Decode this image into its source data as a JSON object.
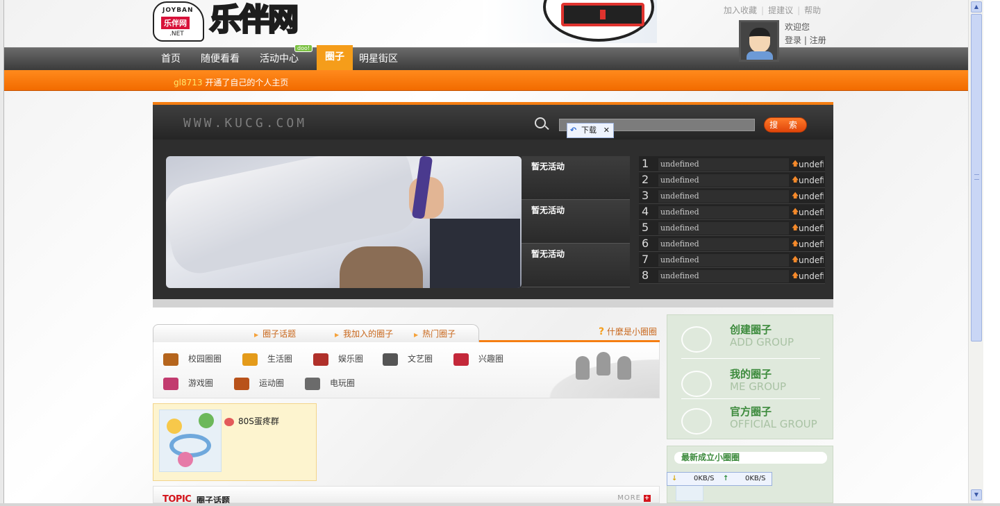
{
  "header": {
    "logo_small": "JOYBAN",
    "logo_cn": "乐伴网",
    "logo_net": ".NET",
    "logo_big": "乐伴网",
    "top_links": [
      "加入收藏",
      "提建议",
      "帮助"
    ],
    "welcome": "欢迎您",
    "login": "登录",
    "register": "注册"
  },
  "nav": {
    "items": [
      "首页",
      "随便看看",
      "活动中心",
      "圈子",
      "明星街区"
    ],
    "active": "圈子",
    "new_badge": "doo!"
  },
  "ticker": {
    "user": "gl8713",
    "message": "开通了自己的个人主页"
  },
  "search": {
    "site_url": "WWW.KUCG.COM",
    "input_value": "",
    "button_label": "搜 索",
    "download_tip": "下载",
    "download_arrow": "↶",
    "download_close": "✕"
  },
  "activities": [
    "暂无活动",
    "暂无活动",
    "暂无活动"
  ],
  "ranking": [
    {
      "rank": "1",
      "name": "undefined",
      "value": "undefi"
    },
    {
      "rank": "2",
      "name": "undefined",
      "value": "undefi"
    },
    {
      "rank": "3",
      "name": "undefined",
      "value": "undefi"
    },
    {
      "rank": "4",
      "name": "undefined",
      "value": "undefi"
    },
    {
      "rank": "5",
      "name": "undefined",
      "value": "undefi"
    },
    {
      "rank": "6",
      "name": "undefined",
      "value": "undefi"
    },
    {
      "rank": "7",
      "name": "undefined",
      "value": "undefi"
    },
    {
      "rank": "8",
      "name": "undefined",
      "value": "undefi"
    }
  ],
  "groups": {
    "tabs": [
      "圈子话题",
      "我加入的圈子",
      "热门圈子"
    ],
    "whatis_mark": "?",
    "whatis": "什麼是小圈圈",
    "categories": [
      "校园圈圈",
      "生活圈",
      "娱乐圈",
      "文艺圈",
      "兴趣圈",
      "游戏圈",
      "运动圈",
      "电玩圈"
    ],
    "category_colors": [
      "#b5651d",
      "#e49b1a",
      "#b0302a",
      "#555555",
      "#c4283a",
      "#c23b6f",
      "#b8521a",
      "#6b6b6b"
    ]
  },
  "circle_card": {
    "name": "80S蛋疼群"
  },
  "topic": {
    "en": "TOPIC",
    "cn": "圈子话题",
    "more": "MORE",
    "more_icon": "+"
  },
  "sidebar": {
    "items": [
      {
        "cn": "创建圈子",
        "en": "ADD GROUP",
        "icon": "group-add-icon"
      },
      {
        "cn": "我的圈子",
        "en": "ME GROUP",
        "icon": "my-group-icon"
      },
      {
        "cn": "官方圈子",
        "en": "OFFICIAL GROUP",
        "icon": "lightbulb-icon"
      }
    ],
    "newest_title": "最新成立小圈圈"
  },
  "speed": {
    "down": "0KB/S",
    "up": "0KB/S"
  },
  "colors": {
    "accent_orange": "#f57e12",
    "nav_dark": "#3b3b3b",
    "green": "#3d8b3d",
    "topic_red": "#d4141c"
  }
}
